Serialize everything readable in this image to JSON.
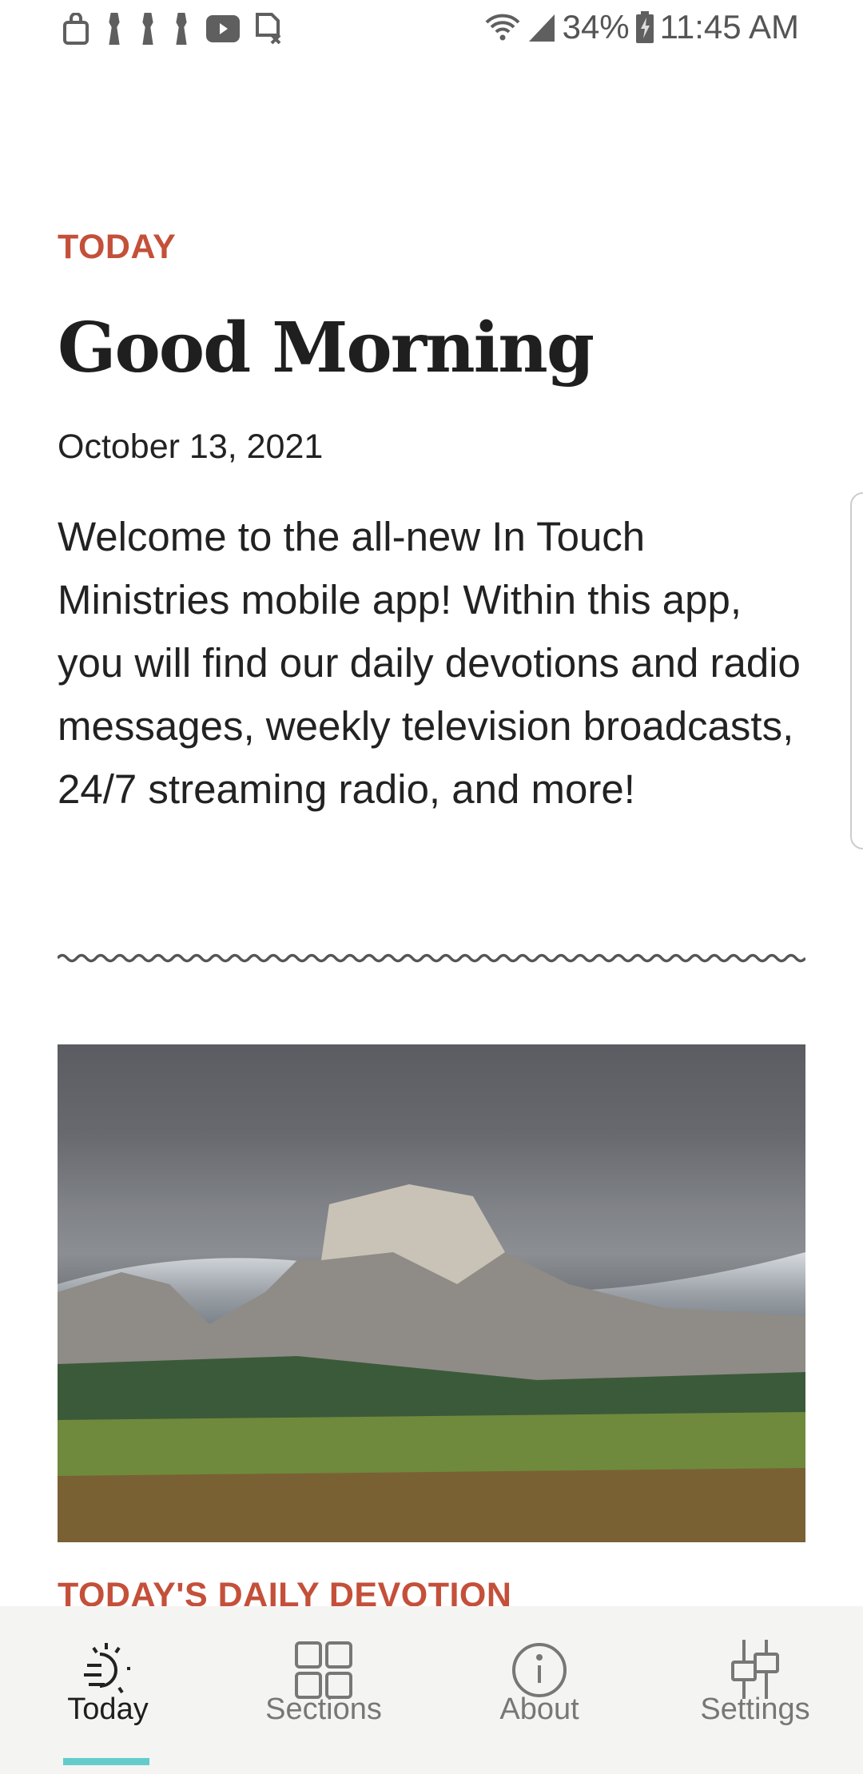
{
  "status_bar": {
    "left_icons": [
      "shopping-bag-icon",
      "keyhole-icon",
      "keyhole-icon",
      "keyhole-icon",
      "youtube-icon",
      "no-sim-icon"
    ],
    "battery": "34%",
    "time": "11:45 AM"
  },
  "main": {
    "section_label": "TODAY",
    "title": "Good Morning",
    "date": "October 13, 2021",
    "intro": "Welcome to the all-new In Touch Ministries mobile app! Within this app, you will find our daily devotions and radio messages, weekly television broadcasts, 24/7 streaming radio, and more!",
    "devotion_label": "TODAY'S DAILY DEVOTION"
  },
  "nav": {
    "items": [
      {
        "label": "Today",
        "icon": "sunrise-icon",
        "active": true
      },
      {
        "label": "Sections",
        "icon": "grid-icon"
      },
      {
        "label": "About",
        "icon": "info-icon"
      },
      {
        "label": "Settings",
        "icon": "sliders-icon"
      }
    ]
  },
  "colors": {
    "accent": "#c4503a",
    "indicator": "#63cccb",
    "nav_bg": "#f4f4f2"
  }
}
